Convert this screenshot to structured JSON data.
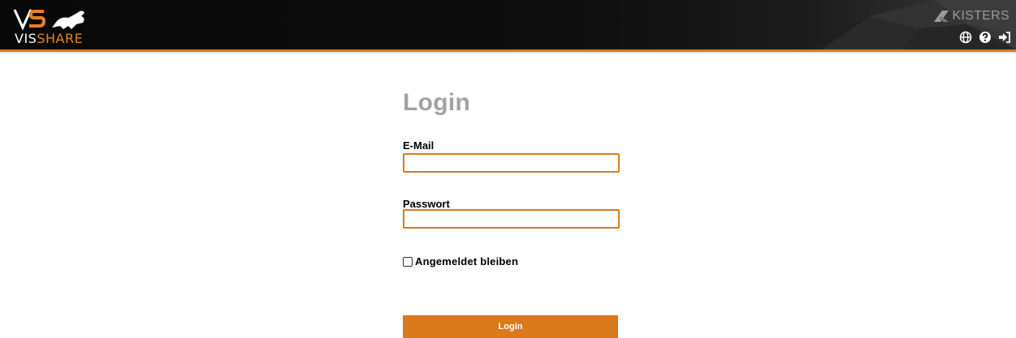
{
  "header": {
    "logo": {
      "mark": "VS",
      "text_white": "VIS",
      "text_accent": "SHARE"
    },
    "brand": {
      "name": "KISTERS",
      "icon": "kisters-logo-icon"
    },
    "icons": [
      {
        "name": "language-globe-icon"
      },
      {
        "name": "help-icon"
      },
      {
        "name": "sign-in-icon"
      }
    ],
    "colors": {
      "accent": "#d97a1d",
      "background": "#0a0a0a"
    }
  },
  "login": {
    "title": "Login",
    "email_label": "E-Mail",
    "email_value": "",
    "password_label": "Passwort",
    "password_value": "",
    "remember_label": "Angemeldet bleiben",
    "remember_checked": false,
    "submit_label": "Login"
  }
}
